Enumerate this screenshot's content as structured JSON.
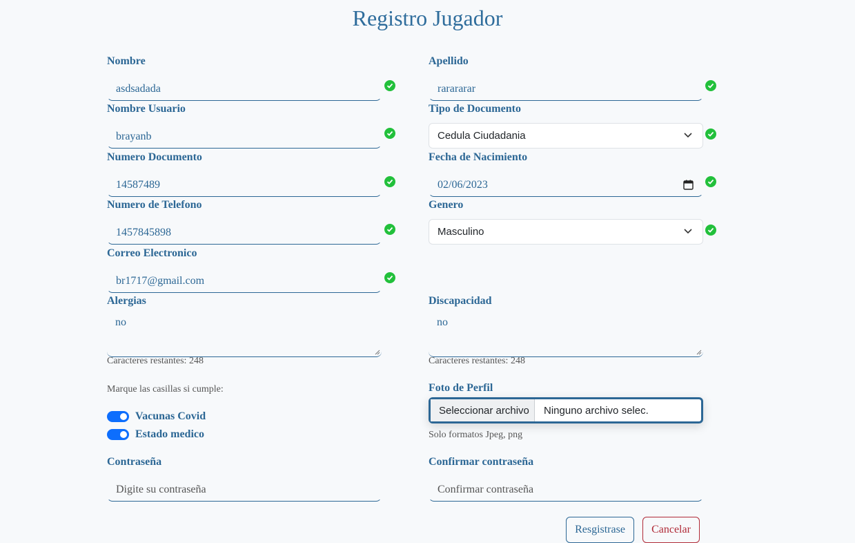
{
  "title": "Registro Jugador",
  "fields": {
    "nombre": {
      "label": "Nombre",
      "value": "asdsadada"
    },
    "apellido": {
      "label": "Apellido",
      "value": "rarararar"
    },
    "usuario": {
      "label": "Nombre Usuario",
      "value": "brayanb"
    },
    "tipo_doc": {
      "label": "Tipo de Documento",
      "value": "Cedula Ciudadania"
    },
    "num_doc": {
      "label": "Numero Documento",
      "value": "14587489"
    },
    "fecha": {
      "label": "Fecha de Nacimiento",
      "value": "02/06/2023"
    },
    "telefono": {
      "label": "Numero de Telefono",
      "value": "1457845898"
    },
    "genero": {
      "label": "Genero",
      "value": "Masculino"
    },
    "correo": {
      "label": "Correo Electronico",
      "value": "br1717@gmail.com"
    },
    "alergias": {
      "label": "Alergias",
      "value": "no",
      "counter": "Caracteres restantes: 248"
    },
    "discapacidad": {
      "label": "Discapacidad",
      "value": "no",
      "counter": "Caracteres restantes: 248"
    },
    "contrasena": {
      "label": "Contraseña",
      "placeholder": "Digite su contraseña"
    },
    "confirmar": {
      "label": "Confirmar contraseña",
      "placeholder": "Confirmar contraseña"
    }
  },
  "checkboxes": {
    "instruction": "Marque las casillas si cumple:",
    "vacunas": {
      "label": "Vacunas Covid",
      "checked": true
    },
    "estado": {
      "label": "Estado medico",
      "checked": true
    }
  },
  "foto": {
    "label": "Foto de Perfil",
    "button": "Seleccionar archivo",
    "file_name": "Ninguno archivo selec.",
    "hint": "Solo formatos Jpeg, png"
  },
  "buttons": {
    "register": "Resgistrase",
    "cancel": "Cancelar"
  },
  "colors": {
    "accent": "#2c6795",
    "valid": "#22c03b",
    "toggle": "#0d6efd",
    "danger": "#b02a37"
  },
  "icons": {
    "valid": "check-circle-icon",
    "select": "chevron-down-icon",
    "date": "calendar-icon"
  }
}
